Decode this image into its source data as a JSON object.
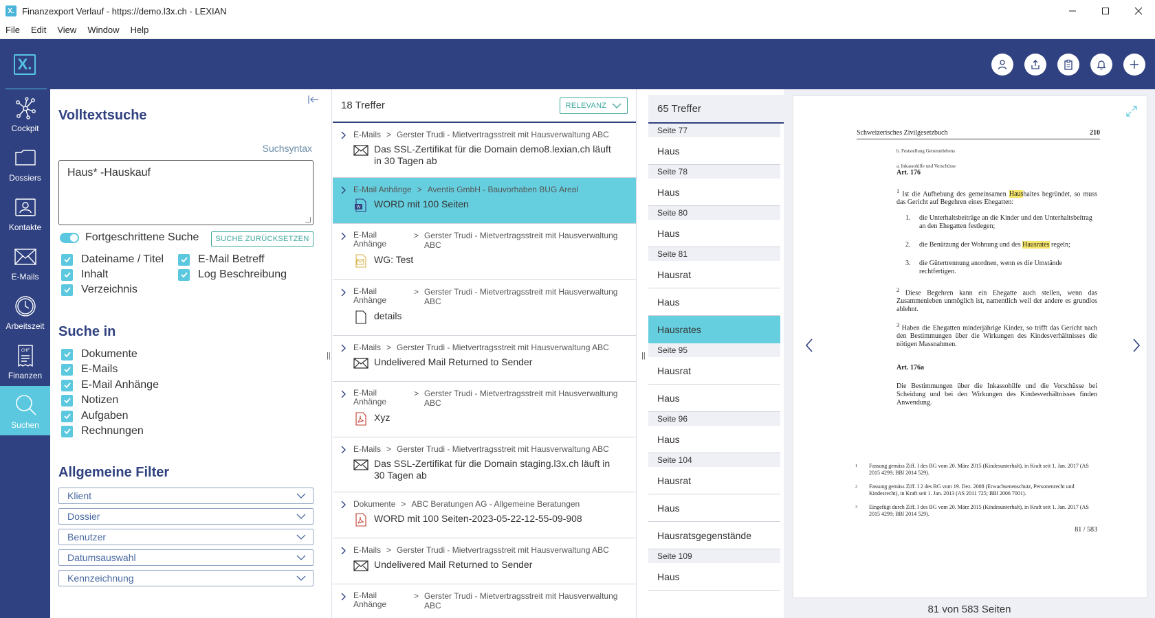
{
  "window": {
    "badge": "X.",
    "title": "Finanzexport Verlauf - https://demo.l3x.ch - LEXIAN"
  },
  "menu": [
    "File",
    "Edit",
    "View",
    "Window",
    "Help"
  ],
  "header": {
    "logo": "X."
  },
  "nav": [
    {
      "label": "Cockpit",
      "icon": "network-icon"
    },
    {
      "label": "Dossiers",
      "icon": "folder-icon"
    },
    {
      "label": "Kontakte",
      "icon": "contact-card-icon"
    },
    {
      "label": "E-Mails",
      "icon": "envelope-icon"
    },
    {
      "label": "Arbeitszeit",
      "icon": "clock-icon"
    },
    {
      "label": "Finanzen",
      "icon": "invoice-icon",
      "badge": "CHF"
    },
    {
      "label": "Suchen",
      "icon": "search-icon",
      "active": true
    }
  ],
  "filters": {
    "title": "Volltextsuche",
    "syntax_link": "Suchsyntax",
    "query": "Haus* -Hauskauf",
    "advanced_label": "Fortgeschrittene Suche",
    "reset_label": "SUCHE ZURÜCKSETZEN",
    "fields": [
      "Dateiname / Titel",
      "E-Mail Betreff",
      "Inhalt",
      "Log Beschreibung",
      "Verzeichnis"
    ],
    "search_in_title": "Suche in",
    "search_in": [
      "Dokumente",
      "E-Mails",
      "E-Mail Anhänge",
      "Notizen",
      "Aufgaben",
      "Rechnungen"
    ],
    "general_title": "Allgemeine Filter",
    "dropdowns": [
      "Klient",
      "Dossier",
      "Benutzer",
      "Datumsauswahl",
      "Kennzeichnung"
    ]
  },
  "results": {
    "count": "18 Treffer",
    "sort_label": "RELEVANZ",
    "items": [
      {
        "category": "E-Mails",
        "path": "Gerster Trudi - Mietvertragsstreit mit Hausverwaltung ABC",
        "title": "Das SSL-Zertifikat für die Domain demo8.lexian.ch läuft in 30 Tagen ab",
        "icon": "envelope-icon"
      },
      {
        "category": "E-Mail Anhänge",
        "path": "Aventis GmbH - Bauvorhaben BUG Areal",
        "title": "WORD mit 100 Seiten",
        "icon": "word-file-icon",
        "selected": true
      },
      {
        "category": "E-Mail Anhänge",
        "path": "Gerster Trudi - Mietvertragsstreit mit Hausverwaltung ABC",
        "title": "WG: Test",
        "icon": "email-file-icon"
      },
      {
        "category": "E-Mail Anhänge",
        "path": "Gerster Trudi - Mietvertragsstreit mit Hausverwaltung ABC",
        "title": "details",
        "icon": "blank-file-icon"
      },
      {
        "category": "E-Mails",
        "path": "Gerster Trudi - Mietvertragsstreit mit Hausverwaltung ABC",
        "title": "Undelivered Mail Returned to Sender",
        "icon": "envelope-icon"
      },
      {
        "category": "E-Mail Anhänge",
        "path": "Gerster Trudi - Mietvertragsstreit mit Hausverwaltung ABC",
        "title": "Xyz",
        "icon": "pdf-file-icon"
      },
      {
        "category": "E-Mails",
        "path": "Gerster Trudi - Mietvertragsstreit mit Hausverwaltung ABC",
        "title": "Das SSL-Zertifikat für die Domain staging.l3x.ch läuft in 30 Tagen ab",
        "icon": "envelope-icon"
      },
      {
        "category": "Dokumente",
        "path": "ABC Beratungen AG - Allgemeine Beratungen",
        "title": "WORD mit 100 Seiten-2023-05-22-12-55-09-908",
        "icon": "pdf-file-icon"
      },
      {
        "category": "E-Mails",
        "path": "Gerster Trudi - Mietvertragsstreit mit Hausverwaltung ABC",
        "title": "Undelivered Mail Returned to Sender",
        "icon": "envelope-icon"
      },
      {
        "category": "E-Mail Anhänge",
        "path": "Gerster Trudi - Mietvertragsstreit mit Hausverwaltung ABC",
        "title": "",
        "icon": "blank-file-icon"
      }
    ]
  },
  "pages": {
    "count": "65 Treffer",
    "rows": [
      {
        "type": "label",
        "text": "Seite 77"
      },
      {
        "type": "hit",
        "text": "Haus"
      },
      {
        "type": "label",
        "text": "Seite 78"
      },
      {
        "type": "hit",
        "text": "Haus"
      },
      {
        "type": "label",
        "text": "Seite 80"
      },
      {
        "type": "hit",
        "text": "Haus"
      },
      {
        "type": "label",
        "text": "Seite 81"
      },
      {
        "type": "hit",
        "text": "Hausrat"
      },
      {
        "type": "hit",
        "text": "Haus"
      },
      {
        "type": "hit",
        "text": "Hausrates",
        "selected": true
      },
      {
        "type": "label",
        "text": "Seite 95"
      },
      {
        "type": "hit",
        "text": "Hausrat"
      },
      {
        "type": "hit",
        "text": "Haus"
      },
      {
        "type": "label",
        "text": "Seite 96"
      },
      {
        "type": "hit",
        "text": "Haus"
      },
      {
        "type": "label",
        "text": "Seite 104"
      },
      {
        "type": "hit",
        "text": "Hausrat"
      },
      {
        "type": "hit",
        "text": "Haus"
      },
      {
        "type": "hit",
        "text": "Hausratsgegenstände"
      },
      {
        "type": "label",
        "text": "Seite 109"
      },
      {
        "type": "hit",
        "text": "Haus"
      }
    ]
  },
  "viewer": {
    "page_counter": "81 von 583 Seiten",
    "doc": {
      "header_left": "Schweizerisches Zivilgesetzbuch",
      "header_right": "210",
      "small1": "b. Feststellung Getrenntlebens",
      "small2": "a. Inkassohilfe und Vorschüsse",
      "art1": "Art. 176",
      "p1_a": "Ist die Aufhebung des gemeinsamen ",
      "p1_hl": "Haus",
      "p1_b": "haltes begründet, so muss das Gericht auf Begehren eines Ehegatten:",
      "li1_num": "1.",
      "li1": "die Unterhaltsbeiträge an die Kinder und den Unterhaltsbeitrag an den Ehegatten festlegen;",
      "li2_num": "2.",
      "li2_a": "die Benützung der Wohnung und des ",
      "li2_hl": "Hausrates",
      "li2_b": " regeln;",
      "li3_num": "3.",
      "li3": "die Gütertrennung anordnen, wenn es die Umstände rechtfertigen.",
      "p2": "Diese Begehren kann ein Ehegatte auch stellen, wenn das Zusammenleben unmöglich ist, namentlich weil der andere es grundlos ablehnt.",
      "p3": "Haben die Ehegatten minderjährige Kinder, so trifft das Gericht nach den Bestimmungen über die Wirkungen des Kindesverhältnisses die nötigen Massnahmen.",
      "art2": "Art. 176a",
      "p4": "Die Bestimmungen über die Inkassohilfe und die Vorschüsse bei Scheidung und bei den Wirkungen des Kindesverhältnisses finden Anwendung.",
      "fn1": "Fassung gemäss Ziff. I des BG vom 20. März 2015 (Kindesunterhalt), in Kraft seit 1. Jan. 2017 (AS 2015 4299; BBl 2014 529).",
      "fn2": "Fassung gemäss Ziff. I 2 des BG vom 19. Dez. 2008 (Erwachsenenschutz, Personenrecht und Kindesrecht), in Kraft seit 1. Jan. 2013 (AS 2011 725; BBl 2006 7001).",
      "fn3": "Eingefügt durch Ziff. I des BG vom 20. März 2015 (Kindesunterhalt), in Kraft seit 1. Jan. 2017 (AS 2015 4299; BBl 2014 529).",
      "page_no": "81 / 583"
    }
  },
  "colors": {
    "navy": "#2f4180",
    "accent": "#5bc8df",
    "selected": "#66cfdf",
    "teal": "#3da89c",
    "highlight": "#f5e66a"
  }
}
